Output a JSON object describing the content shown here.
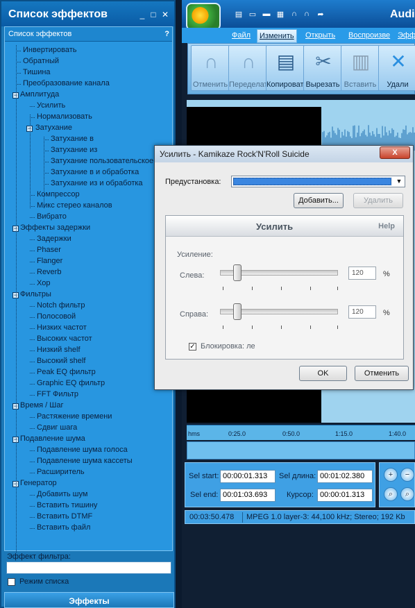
{
  "effects_panel": {
    "title": "Список эффектов",
    "header": "Список эффектов",
    "help": "?",
    "window_buttons": [
      "_",
      "□",
      "✕"
    ],
    "filter_label": "Эффект фильтра:",
    "filter_value": "",
    "list_mode_label": "Режим списка",
    "effects_tab": "Эффекты"
  },
  "tree": [
    {
      "label": "Инвертировать",
      "level": 1
    },
    {
      "label": "Обратный",
      "level": 1
    },
    {
      "label": "Тишина",
      "level": 1
    },
    {
      "label": "Преобразование канала",
      "level": 1
    },
    {
      "label": "Амплитуда",
      "level": 0,
      "expanded": true
    },
    {
      "label": "Усилить",
      "level": 2
    },
    {
      "label": "Нормализовать",
      "level": 2
    },
    {
      "label": "Затухание",
      "level": 1.5,
      "expanded": true
    },
    {
      "label": "Затухание в",
      "level": 3
    },
    {
      "label": "Затухание из",
      "level": 3
    },
    {
      "label": "Затухание пользовательское",
      "level": 3
    },
    {
      "label": "Затухание в и обработка",
      "level": 3
    },
    {
      "label": "Затухание из и обработка",
      "level": 3
    },
    {
      "label": "Компрессор",
      "level": 2
    },
    {
      "label": "Микс стерео каналов",
      "level": 2
    },
    {
      "label": "Вибрато",
      "level": 2
    },
    {
      "label": "Эффекты задержки",
      "level": 0,
      "expanded": true
    },
    {
      "label": "Задержки",
      "level": 2
    },
    {
      "label": "Phaser",
      "level": 2
    },
    {
      "label": "Flanger",
      "level": 2
    },
    {
      "label": "Reverb",
      "level": 2
    },
    {
      "label": "Хор",
      "level": 2
    },
    {
      "label": "Фильтры",
      "level": 0,
      "expanded": true
    },
    {
      "label": "Notch фильтр",
      "level": 2
    },
    {
      "label": "Полосовой",
      "level": 2
    },
    {
      "label": "Низких частот",
      "level": 2
    },
    {
      "label": "Высоких частот",
      "level": 2
    },
    {
      "label": "Низкий shelf",
      "level": 2
    },
    {
      "label": "Высокий shelf",
      "level": 2
    },
    {
      "label": "Peak EQ фильтр",
      "level": 2
    },
    {
      "label": "Graphic EQ фильтр",
      "level": 2
    },
    {
      "label": "FFT Фильтр",
      "level": 2
    },
    {
      "label": "Время / Шаг",
      "level": 0,
      "expanded": true
    },
    {
      "label": "Растяжение времени",
      "level": 2
    },
    {
      "label": "Сдвиг шага",
      "level": 2
    },
    {
      "label": "Подавление шума",
      "level": 0,
      "expanded": true
    },
    {
      "label": "Подавление шума голоса",
      "level": 2
    },
    {
      "label": "Подавление шума кассеты",
      "level": 2
    },
    {
      "label": "Расширитель",
      "level": 2
    },
    {
      "label": "Генератор",
      "level": 0,
      "expanded": true
    },
    {
      "label": "Добавить шум",
      "level": 2
    },
    {
      "label": "Вставить тишину",
      "level": 2
    },
    {
      "label": "Вставить DTMF",
      "level": 2
    },
    {
      "label": "Вставить файл",
      "level": 2
    }
  ],
  "app": {
    "title": "Audi",
    "menu": [
      "Файл",
      "Изменить",
      "Открыть",
      "Воспроизве",
      "Эффе"
    ],
    "active_menu_index": 1,
    "ribbon": [
      {
        "label": "Отменить",
        "icon": "undo-icon",
        "disabled": true
      },
      {
        "label": "Переделать",
        "icon": "redo-icon",
        "disabled": true
      },
      {
        "label": "Копировать",
        "icon": "copy-icon",
        "disabled": false
      },
      {
        "label": "Вырезать",
        "icon": "cut-icon",
        "disabled": false
      },
      {
        "label": "Вставить",
        "icon": "paste-icon",
        "disabled": true
      },
      {
        "label": "Удали",
        "icon": "delete-icon",
        "disabled": false
      }
    ],
    "timeline_ticks": [
      "hms",
      "0:25.0",
      "0:50.0",
      "1:15.0",
      "1:40.0"
    ],
    "sel_start_label": "Sel start:",
    "sel_start": "00:00:01.313",
    "sel_length_label": "Sel длина:",
    "sel_length": "00:01:02.380",
    "sel_end_label": "Sel end:",
    "sel_end": "00:01:03.693",
    "cursor_label": "Курсор:",
    "cursor": "00:00:01.313",
    "duration": "00:03:50.478",
    "format": "MPEG 1.0 layer-3: 44,100 kHz; Stereo; 192 Kb"
  },
  "dialog": {
    "title": "Усилить - Kamikaze Rock'N'Roll Suicide",
    "close": "X",
    "preset_label": "Предустановка:",
    "preset_value": "",
    "add_button": "Добавить...",
    "delete_button": "Удалить",
    "section_title": "Усилить",
    "help": "Help",
    "gain_label": "Усиление:",
    "left_label": "Слева:",
    "left_value": "120",
    "right_label": "Справа:",
    "right_value": "120",
    "percent": "%",
    "lock_label": "Блокировка: ле",
    "lock_checked": true,
    "ok_button": "OK",
    "cancel_button": "Отменить"
  }
}
